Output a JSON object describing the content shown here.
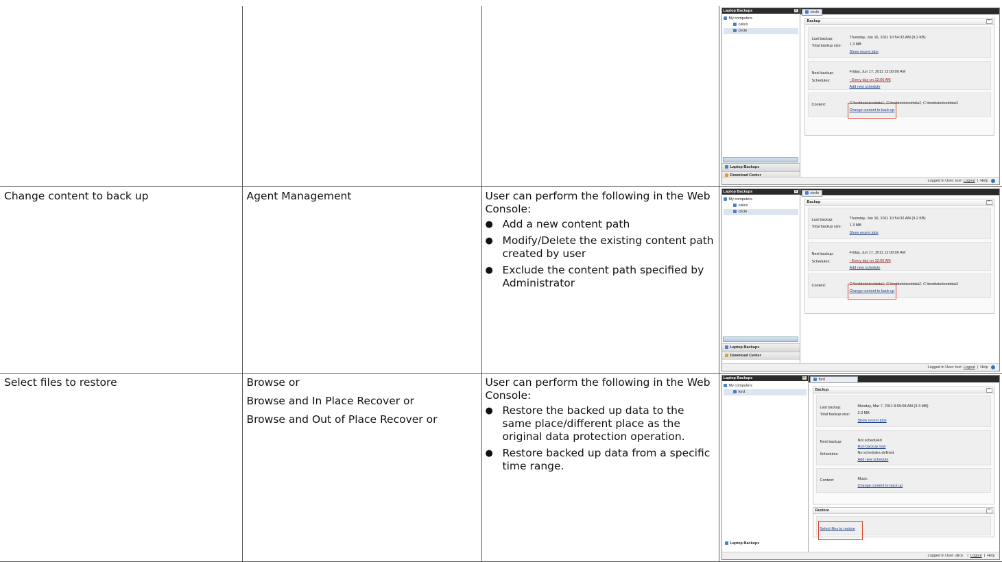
{
  "rows": [
    {
      "task": "",
      "permission": [],
      "description": {
        "intro": "",
        "bullets": []
      }
    },
    {
      "task": "Change content to back up",
      "permission": [
        "Agent Management"
      ],
      "description": {
        "intro": "User can perform the following in the Web Console:",
        "bullets": [
          "Add a new content path",
          "Modify/Delete the existing content path created by user",
          "Exclude the content path specified by Administrator"
        ]
      }
    },
    {
      "task": "Select files to restore",
      "permission": [
        "Browse or",
        "Browse and In Place Recover or",
        "Browse and Out of Place Recover or"
      ],
      "description": {
        "intro": "User can perform the following in the Web Console:",
        "bullets": [
          "Restore the backed up data to the same place/different place as the original data protection operation.",
          "Restore backed up data from a specific time range."
        ]
      }
    }
  ],
  "shot_circle": {
    "left_title": "Laptop Backups",
    "tree_root": "My computers",
    "computers": [
      "calico",
      "circle"
    ],
    "tab": "circle",
    "section": "Backup",
    "last_backup_label": "Last backup:",
    "last_backup_value": "Thursday, Jun 16, 2011 10:54:32 AM (9.2 KB)",
    "total_size_label": "Total backup size:",
    "total_size_value": "1.3 MB",
    "show_recent": "Show recent jobs",
    "next_backup_label": "Next backup:",
    "next_backup_value": "Friday, Jun 17, 2011 12:00:00 AM",
    "schedules_label": "Schedules:",
    "schedule_link": "- Every day on 12:00 AM",
    "add_schedule": "Add new schedule",
    "content_label": "Content:",
    "content_value": "C:\\testdata\\testdata1, C:\\testdata\\testdata2, C:\\testdata\\testdata3",
    "change_content": "Change content to back up",
    "nav_laptop": "Laptop Backups",
    "nav_download": "Download Center",
    "logged_in": "Logged in User: test",
    "logout": "Logout",
    "help": "Help"
  },
  "shot_ford": {
    "left_title": "Laptop Backups",
    "tree_root": "My computers",
    "computer": "ford",
    "tab": "ford",
    "section": "Backup",
    "last_backup_label": "Last backup:",
    "last_backup_value": "Monday, Mar 7, 2011 8:59:08 AM (3.3 MB)",
    "total_size_label": "Total backup size:",
    "total_size_value": "3.3 MB",
    "show_recent": "Show recent jobs",
    "next_backup_label": "Next backup:",
    "next_backup_value": "Not scheduled",
    "run_backup": "Run backup now",
    "schedules_label": "Schedules:",
    "schedules_value": "No schedules defined",
    "add_schedule": "Add new schedule",
    "content_label": "Content:",
    "content_value": "Music",
    "change_content": "Change content to back up",
    "restore_section": "Restore",
    "select_files": "Select files to restore",
    "nav_laptop": "Laptop Backups",
    "logged_in": "Logged in User: alice",
    "logout": "Logout",
    "help": "Help"
  }
}
